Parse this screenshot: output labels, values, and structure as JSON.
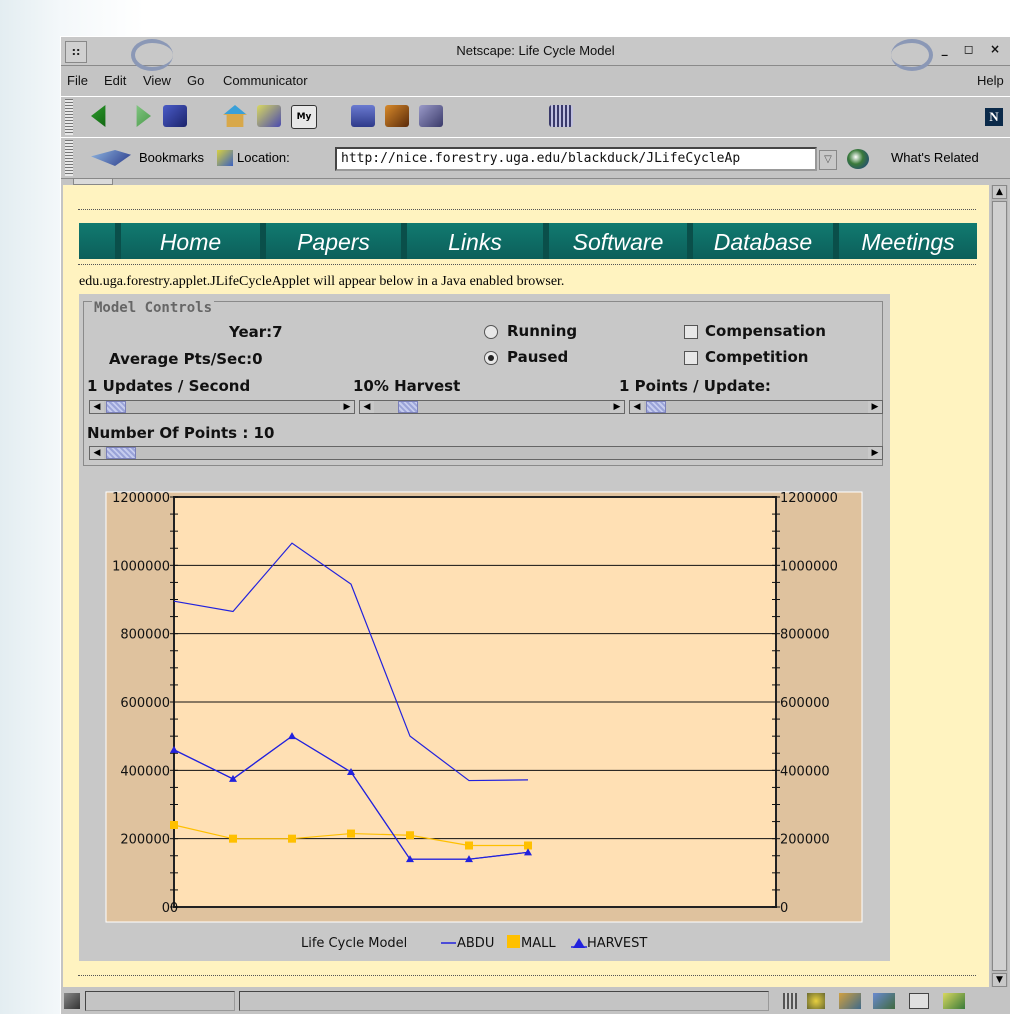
{
  "window": {
    "title": "Netscape: Life Cycle Model",
    "buttons": "_ ◻ ×"
  },
  "menubar": {
    "file": "File",
    "edit": "Edit",
    "view": "View",
    "go": "Go",
    "communicator": "Communicator",
    "help": "Help"
  },
  "locbar": {
    "bookmarks": "Bookmarks",
    "location_label": "Location:",
    "url": "http://nice.forestry.uga.edu/blackduck/JLifeCycleAp",
    "whats_related": "What's Related"
  },
  "nav": {
    "items": [
      "Home",
      "Papers",
      "Links",
      "Software",
      "Database",
      "Meetings"
    ]
  },
  "applet_message": "edu.uga.forestry.applet.JLifeCycleApplet will appear below in a Java enabled browser.",
  "controls": {
    "legend": "Model Controls",
    "year": "Year:7",
    "avg_pts": "Average Pts/Sec:0",
    "running": "Running",
    "paused": "Paused",
    "compensation": "Compensation",
    "competition": "Competition",
    "updates_label": "1 Updates / Second",
    "harvest_label": "10% Harvest",
    "points_label": "1 Points / Update:",
    "num_points_label": "Number Of Points : 10",
    "running_selected": false,
    "paused_selected": true,
    "compensation_checked": false,
    "competition_checked": false
  },
  "chart_data": {
    "type": "line",
    "ylim": [
      0,
      1200000
    ],
    "yticks": [
      "0",
      "200000",
      "400000",
      "600000",
      "800000",
      "1000000",
      "1200000"
    ],
    "x_label_start": "0",
    "legend_title": "Life Cycle Model",
    "x": [
      0,
      1,
      2,
      3,
      4,
      5,
      6
    ],
    "series": [
      {
        "name": "ABDU",
        "color": "#2222dd",
        "marker": "none",
        "values": [
          895000,
          865000,
          1065000,
          945000,
          500000,
          370000,
          372000
        ]
      },
      {
        "name": "MALL",
        "color": "#ffc000",
        "marker": "square",
        "values": [
          240000,
          200000,
          200000,
          215000,
          210000,
          180000,
          180000
        ]
      },
      {
        "name": "HARVEST",
        "color": "#2222dd",
        "marker": "triangle",
        "values": [
          460000,
          375000,
          500000,
          395000,
          140000,
          140000,
          160000
        ]
      },
      {
        "name": "ABDU",
        "color": "#2222dd",
        "marker": "none",
        "values": [
          460000,
          375000,
          500000,
          395000,
          140000,
          140000,
          160000
        ]
      }
    ]
  }
}
